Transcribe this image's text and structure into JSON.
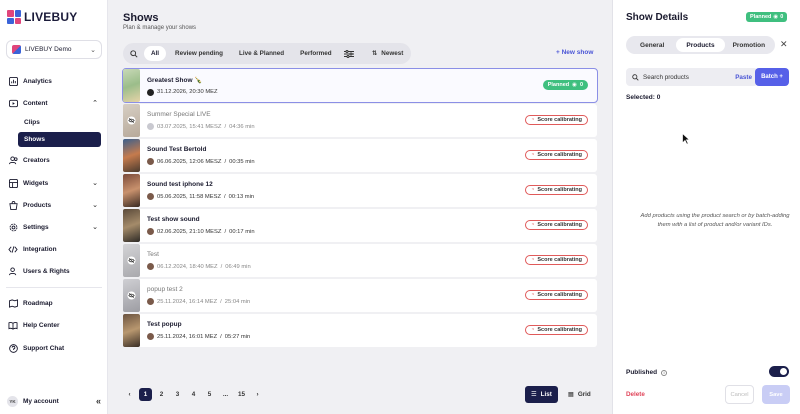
{
  "app": {
    "brand": "LIVEBUY",
    "workspace": "LIVEBUY Demo"
  },
  "sidebar": {
    "items": [
      {
        "label": "Analytics",
        "icon": "analytics-icon"
      },
      {
        "label": "Content",
        "icon": "content-icon"
      },
      {
        "label": "Creators",
        "icon": "creators-icon"
      },
      {
        "label": "Widgets",
        "icon": "widgets-icon"
      },
      {
        "label": "Products",
        "icon": "products-icon"
      },
      {
        "label": "Settings",
        "icon": "settings-icon"
      },
      {
        "label": "Integration",
        "icon": "code-icon"
      },
      {
        "label": "Users & Rights",
        "icon": "users-icon"
      },
      {
        "label": "Roadmap",
        "icon": "roadmap-icon"
      },
      {
        "label": "Help Center",
        "icon": "book-icon"
      },
      {
        "label": "Support Chat",
        "icon": "chat-icon"
      }
    ],
    "content_sub": [
      "Clips",
      "Shows"
    ],
    "account": {
      "initials": "YK",
      "label": "My account"
    }
  },
  "main": {
    "title": "Shows",
    "subtitle": "Plan & manage your shows",
    "filters": [
      "All",
      "Review pending",
      "Live & Planned",
      "Performed"
    ],
    "sort_label": "Newest",
    "new_show_label": "+ New show",
    "shows": [
      {
        "title": "Greatest Show 🍾",
        "date": "31.12.2026, 20:30 MEZ",
        "duration": "",
        "status": "Planned",
        "viewers": "0"
      },
      {
        "title": "Summer Special LIVE",
        "date": "03.07.2025, 15:41 MESZ",
        "duration": "04:36 min",
        "status": "Score calibrating"
      },
      {
        "title": "Sound Test Bertold",
        "date": "06.06.2025, 12:06 MESZ",
        "duration": "00:35 min",
        "status": "Score calibrating"
      },
      {
        "title": "Sound test iphone 12",
        "date": "05.06.2025, 11:58 MESZ",
        "duration": "00:13 min",
        "status": "Score calibrating"
      },
      {
        "title": "Test show sound",
        "date": "02.06.2025, 21:10 MESZ",
        "duration": "00:17 min",
        "status": "Score calibrating"
      },
      {
        "title": "Test",
        "date": "06.12.2024, 18:40 MEZ",
        "duration": "06:49 min",
        "status": "Score calibrating"
      },
      {
        "title": "popup test 2",
        "date": "25.11.2024, 16:14 MEZ",
        "duration": "25:04 min",
        "status": "Score calibrating"
      },
      {
        "title": "Test popup",
        "date": "25.11.2024, 16:01 MEZ",
        "duration": "05:27 min",
        "status": "Score calibrating"
      }
    ],
    "pagination": [
      "1",
      "2",
      "3",
      "4",
      "5",
      "...",
      "15"
    ],
    "view_list": "List",
    "view_grid": "Grid"
  },
  "panel": {
    "title": "Show Details",
    "status": "Planned",
    "viewers": "0",
    "tabs": [
      "General",
      "Products",
      "Promotion"
    ],
    "search_placeholder": "Search products",
    "paste": "Paste",
    "batch": "Batch +",
    "selected": "Selected: 0",
    "hint": "Add products using the product search or by batch-adding them with a list of product and/or variant IDs.",
    "published_label": "Published",
    "delete": "Delete",
    "cancel": "Cancel",
    "save": "Save"
  },
  "colors": {
    "accent": "#5660e8",
    "nav_active": "#1b1f4b",
    "planned": "#3fbf7f",
    "calibrating_border": "#e05a5a",
    "delete": "#e0455a"
  }
}
